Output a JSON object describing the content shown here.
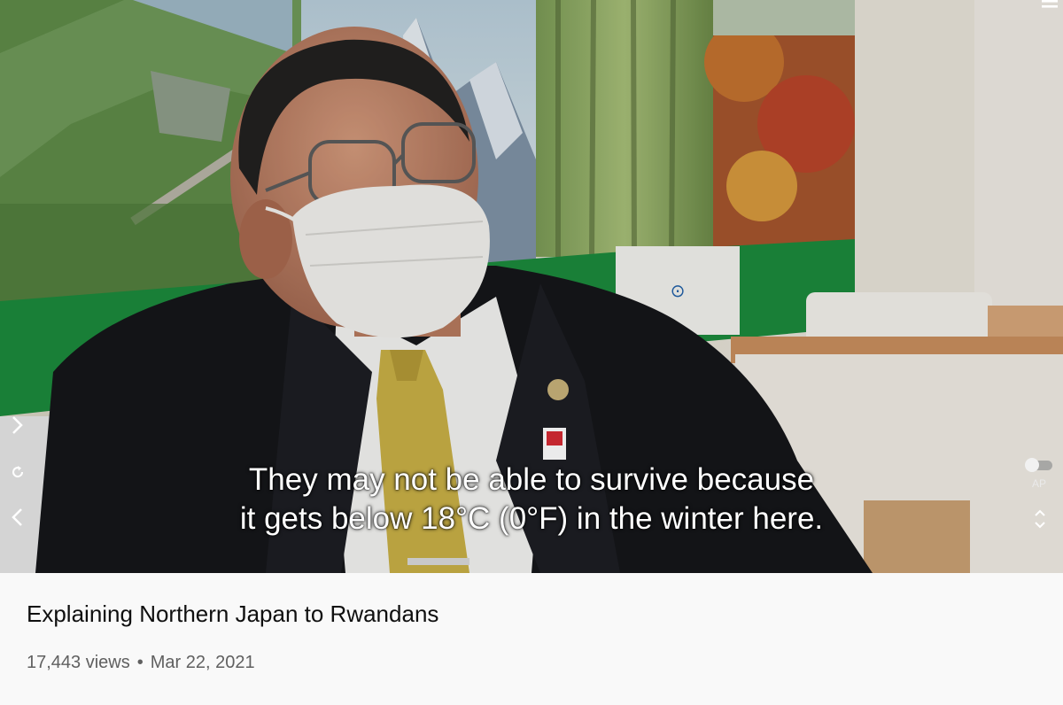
{
  "video": {
    "caption_line1": "They may not be able to survive because",
    "caption_line2": "it gets below 18°C (0°F) in the winter here.",
    "autoplay_label": "AP"
  },
  "details": {
    "title": "Explaining Northern Japan to Rwandans",
    "views": "17,443 views",
    "separator": "•",
    "date": "Mar 22, 2021"
  },
  "icons": {
    "menu": "hamburger-menu-icon",
    "next": "chevron-right-icon",
    "replay": "replay-icon",
    "previous": "chevron-left-icon",
    "autoplay": "autoplay-toggle-icon",
    "expand": "expand-collapse-icon"
  },
  "colors": {
    "banner_green": "#1c8a3c",
    "tie": "#c9b046",
    "suit": "#15161a",
    "meta_text": "#606060",
    "title_text": "#0f0f0f"
  }
}
